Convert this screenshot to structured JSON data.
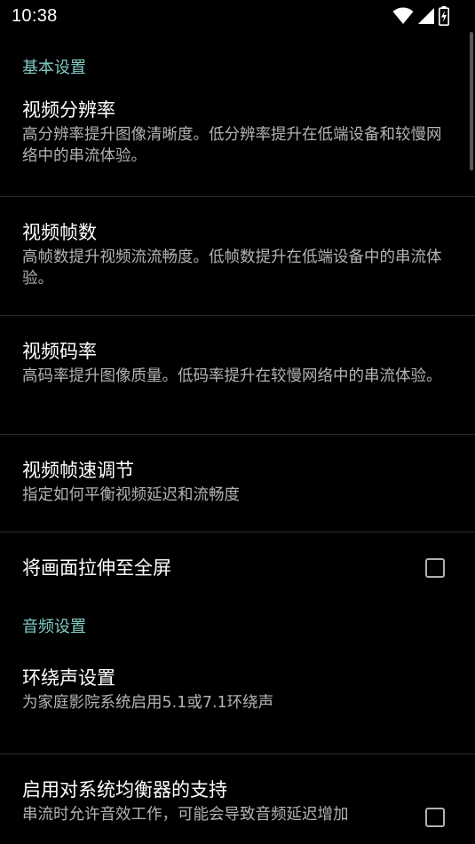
{
  "status_bar": {
    "time": "10:38",
    "icons": [
      "wifi-icon",
      "cellular-signal-icon",
      "battery-charging-icon"
    ]
  },
  "colors": {
    "background": "#000000",
    "category_accent": "#80cbc4",
    "title_text": "#ffffff",
    "summary_text": "#b3b3b3",
    "divider": "#2b2b2b"
  },
  "sections": {
    "basic": {
      "header": "基本设置",
      "items": {
        "resolution": {
          "title": "视频分辨率",
          "summary": "高分辨率提升图像清晰度。低分辨率提升在低端设备和较慢网络中的串流体验。"
        },
        "fps": {
          "title": "视频帧数",
          "summary": "高帧数提升视频流流畅度。低帧数提升在低端设备中的串流体验。"
        },
        "bitrate": {
          "title": "视频码率",
          "summary": "高码率提升图像质量。低码率提升在较慢网络中的串流体验。"
        },
        "frame_pacing": {
          "title": "视频帧速调节",
          "summary": "指定如何平衡视频延迟和流畅度"
        },
        "stretch": {
          "title": "将画面拉伸至全屏",
          "checked": false
        }
      }
    },
    "audio": {
      "header": "音频设置",
      "items": {
        "surround": {
          "title": "环绕声设置",
          "summary": "为家庭影院系统启用5.1或7.1环绕声"
        },
        "equalizer": {
          "title": "启用对系统均衡器的支持",
          "summary": "串流时允许音效工作，可能会导致音频延迟增加",
          "checked": false
        }
      }
    }
  }
}
